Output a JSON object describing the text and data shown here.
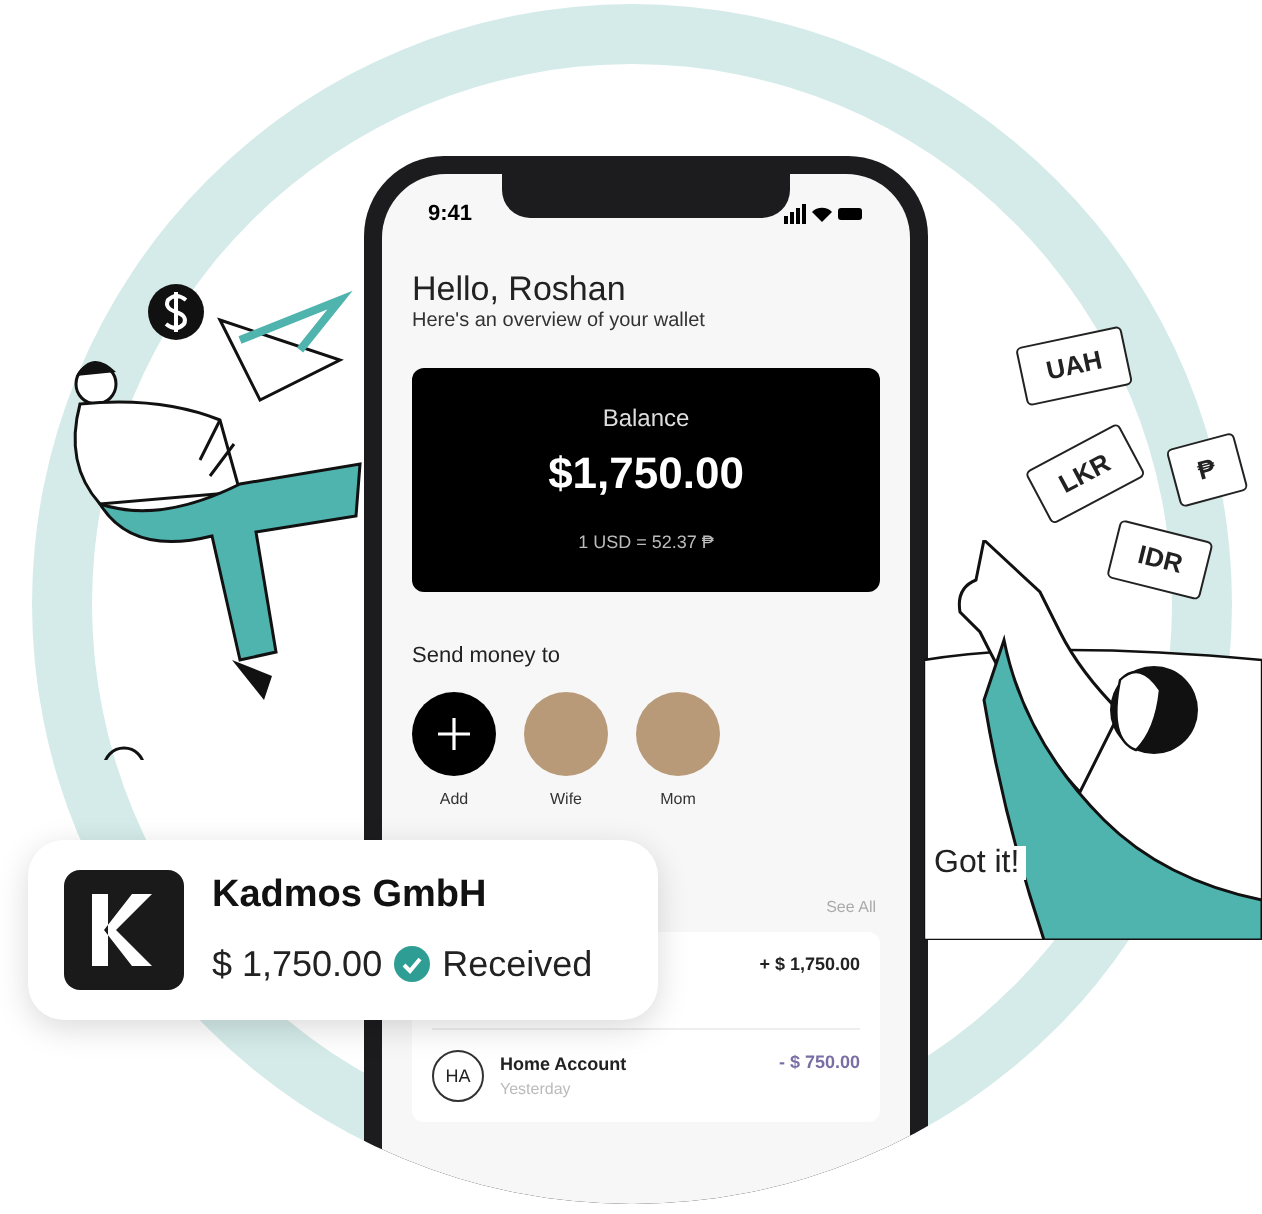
{
  "phone": {
    "status_bar": {
      "time": "9:41"
    },
    "greeting": "Hello, Roshan",
    "subtitle": "Here's an overview of your wallet",
    "balance_card": {
      "label": "Balance",
      "amount": "$1,750.00",
      "rate": "1 USD = 52.37 ₱"
    },
    "send_money": {
      "title": "Send money to",
      "contacts": [
        {
          "kind": "add",
          "name": "Add"
        },
        {
          "kind": "photo",
          "name": "Wife"
        },
        {
          "kind": "photo",
          "name": "Mom"
        }
      ]
    },
    "transactions": {
      "see_all": "See All",
      "items": [
        {
          "amount": "+ $ 1,750.00",
          "color": "#222222"
        },
        {
          "initials": "HA",
          "name": "Home Account",
          "date": "Yesterday",
          "amount": "- $ 750.00",
          "color": "#7a6fa5"
        }
      ]
    }
  },
  "notification": {
    "company": "Kadmos GmbH",
    "amount": "$ 1,750.00",
    "status": "Received"
  },
  "currency_notes": [
    {
      "label": "UAH"
    },
    {
      "label": "LKR"
    },
    {
      "label": "₱"
    },
    {
      "label": "IDR"
    }
  ],
  "speech_bubble": "Got it!"
}
